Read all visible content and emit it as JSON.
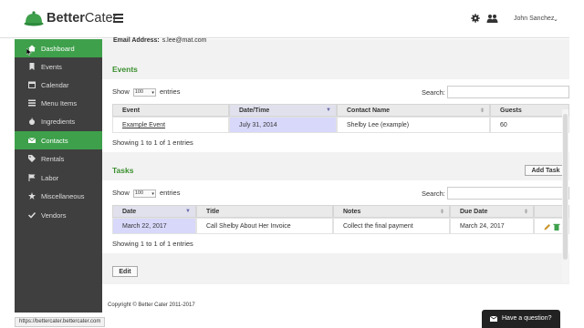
{
  "app": {
    "brand_bold": "Better",
    "brand_rest": "Cater"
  },
  "header": {
    "user_name": "John Sanchez",
    "user_caret": "⌄"
  },
  "sidebar": {
    "items": [
      {
        "label": "Dashboard",
        "icon": "home-icon"
      },
      {
        "label": "Events",
        "icon": "bookmark-icon"
      },
      {
        "label": "Calendar",
        "icon": "calendar-icon"
      },
      {
        "label": "Menu Items",
        "icon": "list-icon"
      },
      {
        "label": "Ingredients",
        "icon": "apple-icon"
      },
      {
        "label": "Contacts",
        "icon": "envelope-icon"
      },
      {
        "label": "Rentals",
        "icon": "tag-icon"
      },
      {
        "label": "Labor",
        "icon": "flag-icon"
      },
      {
        "label": "Miscellaneous",
        "icon": "star-icon"
      },
      {
        "label": "Vendors",
        "icon": "check-icon"
      }
    ],
    "active_indices": [
      0,
      5
    ]
  },
  "contact": {
    "email_label": "Email Address:",
    "email_value": "s.lee@mat.com"
  },
  "events": {
    "title": "Events",
    "show_label": "Show",
    "page_size": "100",
    "entries_label": "entries",
    "search_label": "Search:",
    "columns": [
      "Event",
      "Date/Time",
      "Contact Name",
      "Guests"
    ],
    "rows": [
      [
        "Example Event",
        "July 31, 2014",
        "Shelby Lee (example)",
        "60"
      ]
    ],
    "info": "Showing 1 to 1 of 1 entries"
  },
  "tasks": {
    "title": "Tasks",
    "add_button": "Add Task",
    "show_label": "Show",
    "page_size": "100",
    "entries_label": "entries",
    "search_label": "Search:",
    "columns": [
      "Date",
      "Title",
      "Notes",
      "Due Date"
    ],
    "rows": [
      [
        "March 22, 2017",
        "Call Shelby About Her Invoice",
        "Collect the final payment",
        "March 24, 2017"
      ]
    ],
    "info": "Showing 1 to 1 of 1 entries"
  },
  "edit_button": "Edit",
  "footer": {
    "copyright": "Copyright © Better Cater 2011-2017"
  },
  "status_url": "https://bettercater.bettercater.com",
  "chat": {
    "label": "Have a question?"
  },
  "colors": {
    "accent_green": "#3ea04b",
    "heading_green": "#3a8f2e",
    "sidebar_bg": "#3f3f3f",
    "highlight_cell": "#d8d8fb"
  }
}
